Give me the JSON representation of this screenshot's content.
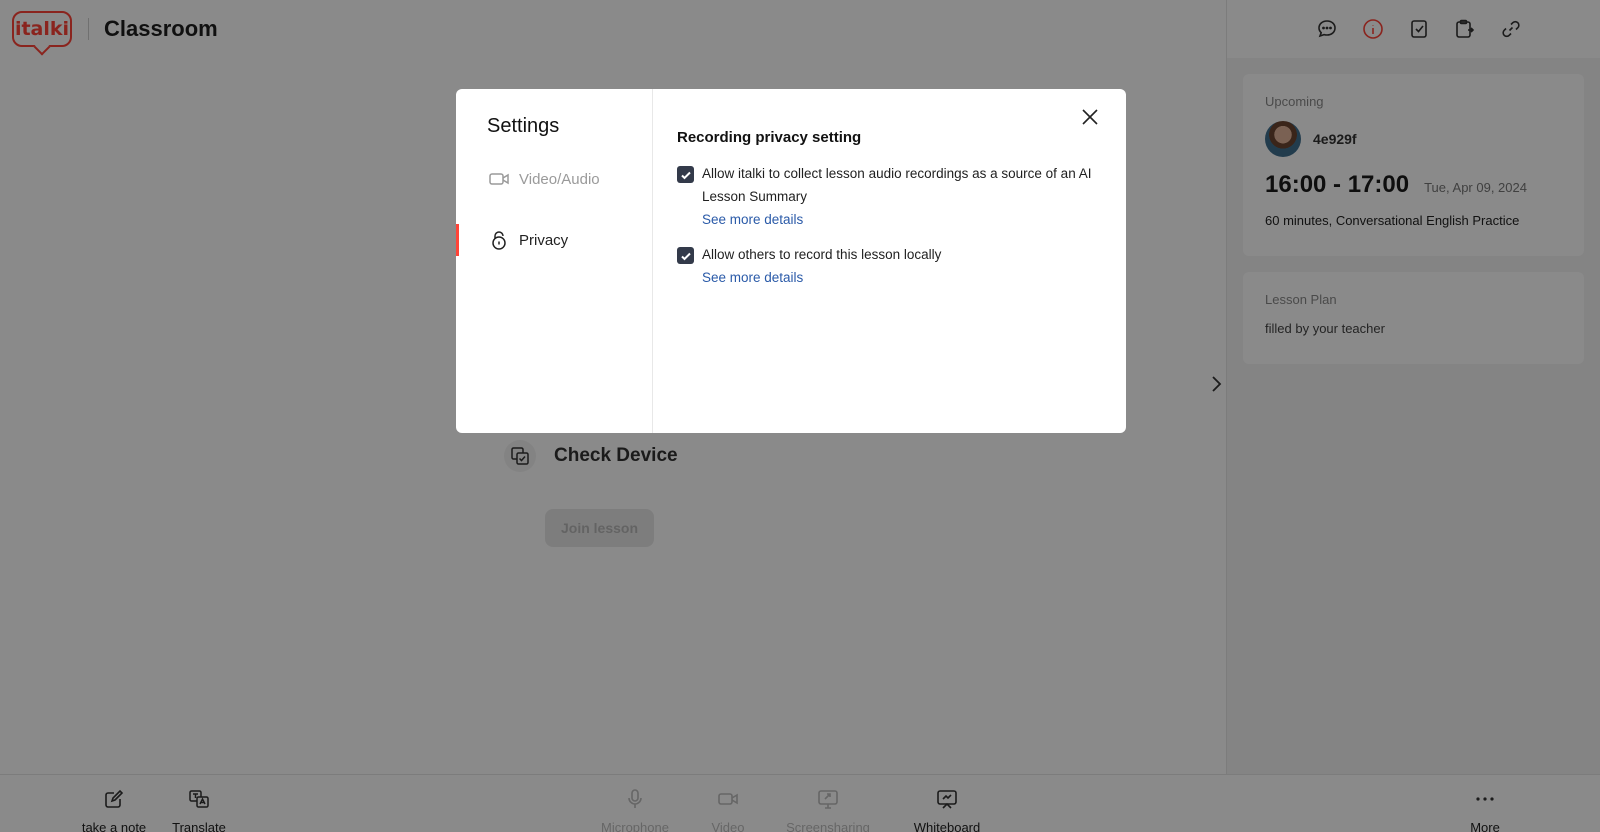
{
  "header": {
    "title": "Classroom",
    "logo_text": "italki"
  },
  "main": {
    "check_device_label": "Check Device",
    "join_button_label": "Join lesson"
  },
  "right_panel": {
    "toolbar_icons": [
      "chat-icon",
      "info-icon",
      "notes-icon",
      "clipboard-icon",
      "link-icon"
    ],
    "upcoming": {
      "label": "Upcoming",
      "teacher_name": "4e929f",
      "time": "16:00 - 17:00",
      "date": "Tue, Apr 09, 2024",
      "description": "60 minutes, Conversational English Practice"
    },
    "lesson_plan": {
      "label": "Lesson Plan",
      "text": "filled by your teacher"
    }
  },
  "bottom_bar": {
    "take_note": "take a note",
    "translate": "Translate",
    "microphone": "Microphone",
    "video": "Video",
    "screensharing": "Screensharing",
    "whiteboard": "Whiteboard",
    "more": "More"
  },
  "modal": {
    "title": "Settings",
    "nav": {
      "video_audio": "Video/Audio",
      "privacy": "Privacy"
    },
    "section_title": "Recording privacy setting",
    "options": [
      {
        "label": "Allow italki to collect lesson audio recordings as a source of an AI Lesson Summary",
        "link": "See more details",
        "checked": true
      },
      {
        "label": "Allow others to record this lesson locally",
        "link": "See more details",
        "checked": true
      }
    ]
  },
  "colors": {
    "brand": "#ff4438",
    "link": "#2a5aa8",
    "checkbox": "#333a4a"
  }
}
